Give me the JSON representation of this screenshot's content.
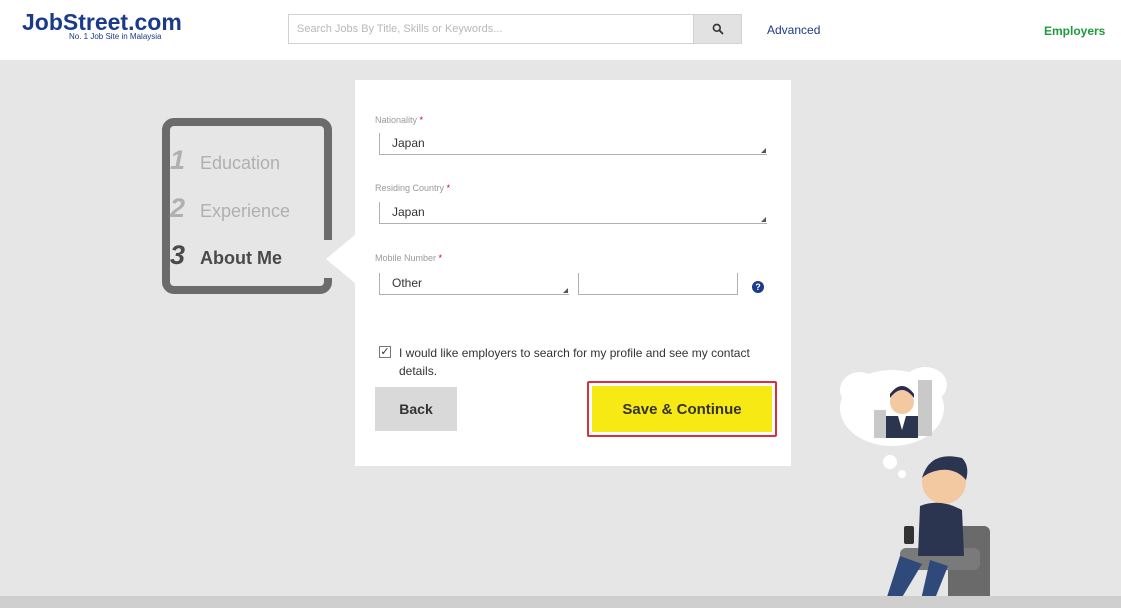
{
  "header": {
    "logo_text": "JobStreet.com",
    "logo_tagline": "No. 1 Job Site in Malaysia",
    "search_placeholder": "Search Jobs By Title, Skills or Keywords...",
    "search_icon": "search-icon",
    "advanced_label": "Advanced",
    "employers_label": "Employers"
  },
  "steps": [
    {
      "number": "1",
      "label": "Education",
      "state": "done"
    },
    {
      "number": "2",
      "label": "Experience",
      "state": "done"
    },
    {
      "number": "3",
      "label": "About Me",
      "state": "active"
    }
  ],
  "form": {
    "nationality": {
      "label": "Nationality",
      "required_mark": "*",
      "value": "Japan"
    },
    "residing_country": {
      "label": "Residing Country",
      "required_mark": "*",
      "value": "Japan"
    },
    "mobile_number": {
      "label": "Mobile Number",
      "required_mark": "*",
      "country_code_value": "Other",
      "number_value": "",
      "help_icon": "question-icon",
      "help_glyph": "?"
    },
    "consent": {
      "checked": true,
      "checkmark": "✓",
      "text": "I would like employers to search for my profile and see my contact details."
    },
    "back_label": "Back",
    "save_label": "Save & Continue"
  },
  "colors": {
    "brand": "#1b3a8a",
    "employers_green": "#1c9c3c",
    "save_yellow": "#f7ea14",
    "highlight_red": "#d9303b",
    "required_red": "#d0021b"
  }
}
